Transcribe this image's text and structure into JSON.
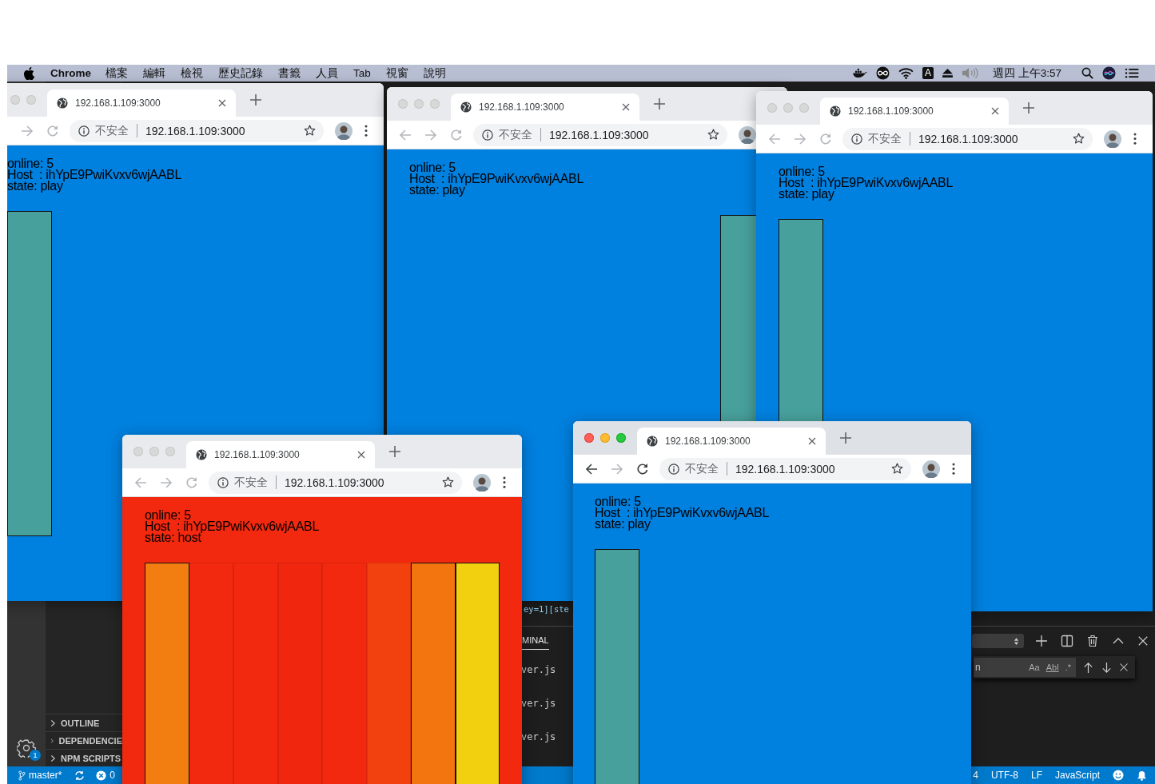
{
  "menu_bar": {
    "app_name": "Chrome",
    "menus": [
      "檔案",
      "編輯",
      "檢視",
      "歷史記錄",
      "書籤",
      "人員",
      "Tab",
      "視窗",
      "說明"
    ],
    "input_source": "A",
    "clock": "週四 上午3:57"
  },
  "windows": [
    {
      "focused": false,
      "tab_title": "192.168.1.109:3000",
      "security_label": "不安全",
      "url": "192.168.1.109:3000",
      "color": "#0080df",
      "lines": [
        "online: 5",
        "Host  : ihYpE9PwiKvxv6wjAABL",
        "state: play"
      ],
      "bars": [
        {
          "filled": true,
          "color": "#48a09c",
          "outlined": true
        },
        {
          "filled": false
        },
        {
          "filled": false
        },
        {
          "filled": false
        },
        {
          "filled": false
        },
        {
          "filled": false
        },
        {
          "filled": false
        },
        {
          "filled": false
        }
      ]
    },
    {
      "focused": false,
      "tab_title": "192.168.1.109:3000",
      "security_label": "不安全",
      "url": "192.168.1.109:3000",
      "color": "#0080df",
      "lines": [
        "online: 5",
        "Host  : ihYpE9PwiKvxv6wjAABL",
        "state: play"
      ],
      "bars": [
        {
          "filled": false
        },
        {
          "filled": false
        },
        {
          "filled": false
        },
        {
          "filled": false
        },
        {
          "filled": false
        },
        {
          "filled": false
        },
        {
          "filled": false
        },
        {
          "filled": true,
          "color": "#48a09c",
          "outlined": true
        }
      ]
    },
    {
      "focused": false,
      "tab_title": "192.168.1.109:3000",
      "security_label": "不安全",
      "url": "192.168.1.109:3000",
      "color": "#0080df",
      "lines": [
        "online: 5",
        "Host  : ihYpE9PwiKvxv6wjAABL",
        "state: play"
      ],
      "bars": [
        {
          "filled": true,
          "color": "#48a09c",
          "outlined": true
        },
        {
          "filled": false
        },
        {
          "filled": false
        },
        {
          "filled": false
        },
        {
          "filled": false
        },
        {
          "filled": false
        },
        {
          "filled": false
        },
        {
          "filled": false
        }
      ]
    },
    {
      "focused": false,
      "tab_title": "192.168.1.109:3000",
      "security_label": "不安全",
      "url": "192.168.1.109:3000",
      "color": "#f3290f",
      "lines": [
        "online: 5",
        "Host  : ihYpE9PwiKvxv6wjAABL",
        "state: host"
      ],
      "bars": [
        {
          "filled": true,
          "color": "#f27d10",
          "outlined": true
        },
        {
          "filled": true,
          "color": "#f3290f",
          "outlined": false
        },
        {
          "filled": true,
          "color": "#f3290f",
          "outlined": false
        },
        {
          "filled": true,
          "color": "#f0260e",
          "outlined": false
        },
        {
          "filled": true,
          "color": "#f3290f",
          "outlined": false
        },
        {
          "filled": true,
          "color": "#f2400f",
          "outlined": false
        },
        {
          "filled": true,
          "color": "#f2750f",
          "outlined": true
        },
        {
          "filled": true,
          "color": "#f2cf0f",
          "outlined": true
        }
      ]
    },
    {
      "focused": true,
      "tab_title": "192.168.1.109:3000",
      "security_label": "不安全",
      "url": "192.168.1.109:3000",
      "color": "#0080df",
      "lines": [
        "online: 5",
        "Host  : ihYpE9PwiKvxv6wjAABL",
        "state: play"
      ],
      "bars": [
        {
          "filled": true,
          "color": "#48a09c",
          "outlined": true
        },
        {
          "filled": false
        },
        {
          "filled": false
        },
        {
          "filled": false
        },
        {
          "filled": false
        },
        {
          "filled": false
        },
        {
          "filled": false
        },
        {
          "filled": false
        }
      ]
    }
  ],
  "editor": {
    "code_fragment": "ey=1][ste"
  },
  "activity_bar": {
    "badge": "1"
  },
  "sidebar": {
    "sections": [
      {
        "title": "OUTLINE",
        "expanded": false
      },
      {
        "title": "DEPENDENCIE",
        "expanded": false
      },
      {
        "title": "NPM SCRIPTS",
        "expanded": false
      }
    ]
  },
  "terminal": {
    "tab": "MINAL",
    "lines": [
      "ver.js",
      "ver.js",
      "ver.js"
    ],
    "find_value": "n",
    "find_options": [
      "Aa",
      "Abl",
      ".*"
    ]
  },
  "status_bar": {
    "branch": "master*",
    "errors": "0",
    "items": [
      "4",
      "UTF-8",
      "LF",
      "JavaScript"
    ]
  }
}
